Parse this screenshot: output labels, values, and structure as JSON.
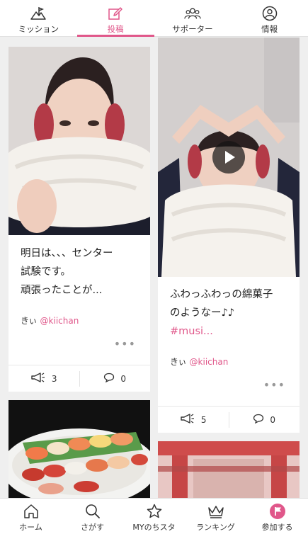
{
  "top_tabs": [
    {
      "label": "ミッション",
      "icon": "mountain-flag-icon",
      "active": false
    },
    {
      "label": "投稿",
      "icon": "edit-icon",
      "active": true
    },
    {
      "label": "サポーター",
      "icon": "people-icon",
      "active": false
    },
    {
      "label": "情報",
      "icon": "user-circle-icon",
      "active": false
    }
  ],
  "posts": [
    {
      "text_lines": [
        "明日は、、、センター",
        "試験です。",
        "頑張ったことが..."
      ],
      "author_name": "きぃ",
      "author_handle": "@kiichan",
      "more": "•••",
      "cheers": "3",
      "comments": "0"
    },
    {
      "text_lines": [
        "ふわっふわっの綿菓子",
        "のようなー♪♪"
      ],
      "hashtag": "#musi...",
      "author_name": "きぃ",
      "author_handle": "@kiichan",
      "more": "•••",
      "cheers": "5",
      "comments": "0"
    }
  ],
  "bottom_nav": [
    {
      "label": "ホーム",
      "icon": "home-icon"
    },
    {
      "label": "さがす",
      "icon": "search-icon"
    },
    {
      "label": "MYのちスタ",
      "icon": "star-icon"
    },
    {
      "label": "ランキング",
      "icon": "crown-icon"
    },
    {
      "label": "参加する",
      "icon": "flag-badge-icon"
    }
  ],
  "colors": {
    "accent": "#e0578a",
    "background": "#efefef"
  }
}
